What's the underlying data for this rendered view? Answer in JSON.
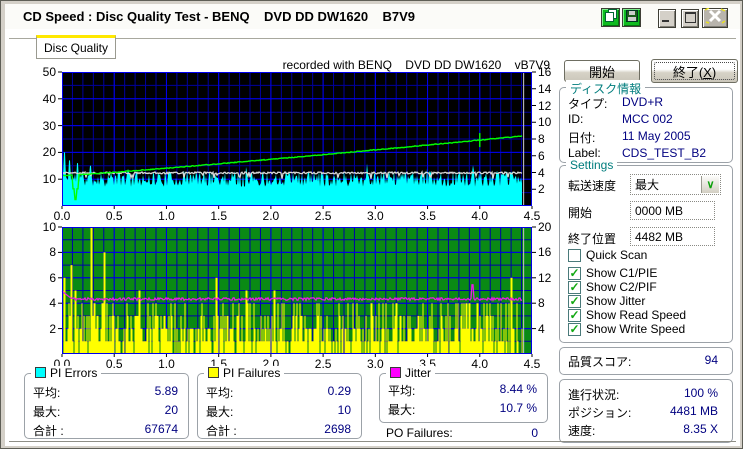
{
  "window": {
    "title": "CD Speed : Disc Quality Test - BENQ    DVD DD DW1620    B7V9"
  },
  "tab": {
    "label": "Disc Quality"
  },
  "chart_header": {
    "recorded_with": "recorded with BENQ    DVD DD DW1620    vB7V9"
  },
  "buttons": {
    "start_label": "開始",
    "exit_label_pre": "終了(",
    "exit_accesskey": "X",
    "exit_label_post": ")"
  },
  "disc_info": {
    "caption": "ディスク情報",
    "type_label": "タイプ:",
    "type_value": "DVD+R",
    "id_label": "ID:",
    "id_value": "MCC 002",
    "date_label": "日付:",
    "date_value": "11 May 2005",
    "label_label": "Label:",
    "label_value": "CDS_TEST_B2"
  },
  "settings": {
    "caption": "Settings",
    "transfer_label": "転送速度",
    "transfer_value": "最大",
    "start_label": "開始",
    "start_value": "0000 MB",
    "end_label": "終了位置",
    "end_value": "4482 MB",
    "checkboxes": [
      {
        "label": "Quick Scan",
        "checked": false
      },
      {
        "label": "Show C1/PIE",
        "checked": true
      },
      {
        "label": "Show C2/PIF",
        "checked": true
      },
      {
        "label": "Show Jitter",
        "checked": true
      },
      {
        "label": "Show Read Speed",
        "checked": true
      },
      {
        "label": "Show Write Speed",
        "checked": true
      }
    ]
  },
  "quality": {
    "label": "品質スコア:",
    "value": "94"
  },
  "status": {
    "progress_label": "進行状況:",
    "progress_value": "100 %",
    "position_label": "ポジション:",
    "position_value": "4481 MB",
    "speed_label": "速度:",
    "speed_value": "8.35 X"
  },
  "stats": {
    "avg_label": "平均:",
    "max_label": "最大:",
    "total_label": "合計 :",
    "pi_errors": {
      "caption": "PI Errors",
      "color": "#00FFFF",
      "avg": "5.89",
      "max": "20",
      "total": "67674"
    },
    "pi_failures": {
      "caption": "PI Failures",
      "color": "#FFFF00",
      "avg": "0.29",
      "max": "10",
      "total": "2698"
    },
    "jitter": {
      "caption": "Jitter",
      "color": "#FF00FF",
      "avg": "8.44 %",
      "max": "10.7 %"
    },
    "po_failures": {
      "label": "PO Failures:",
      "value": "0"
    }
  },
  "chart_data": [
    {
      "type": "area",
      "name": "pi-errors-and-speed",
      "seed": 11,
      "bg": "#000000",
      "grid_minor": "#00009E",
      "grid_major": "#0000EE",
      "marker_color": "#D0D0D0",
      "marker_x": 4.42,
      "data_end_x": 4.4,
      "x": {
        "min": 0,
        "max": 4.5,
        "minor": 0.1,
        "major": 0.5,
        "ticks": [
          [
            0,
            "0.0"
          ],
          [
            0.5,
            "0.5"
          ],
          [
            1,
            "1.0"
          ],
          [
            1.5,
            "1.5"
          ],
          [
            2,
            "2.0"
          ],
          [
            2.5,
            "2.5"
          ],
          [
            3,
            "3.0"
          ],
          [
            3.5,
            "3.5"
          ],
          [
            4,
            "4.0"
          ],
          [
            4.5,
            "4.5"
          ]
        ]
      },
      "left": {
        "max": 50,
        "minor": 5,
        "major": 10,
        "ticks": [
          [
            50,
            "50"
          ],
          [
            40,
            "40"
          ],
          [
            30,
            "30"
          ],
          [
            20,
            "20"
          ],
          [
            10,
            "10"
          ]
        ]
      },
      "right": {
        "max": 16,
        "ticks": [
          [
            16,
            "16"
          ],
          [
            14,
            "14"
          ],
          [
            12,
            "12"
          ],
          [
            10,
            "10"
          ],
          [
            8,
            "8"
          ],
          [
            6,
            "6"
          ],
          [
            4,
            "4"
          ],
          [
            2,
            "2"
          ]
        ]
      },
      "series": [
        {
          "name": "PI Errors",
          "type": "noise-area",
          "color": "#00FFFF",
          "base_min": 7.2,
          "base_max": 13.2,
          "spike_chance": 0.025,
          "spike_add": 5,
          "clamp_max": 20,
          "spikes": [
            [
              0.02,
              20
            ],
            [
              0.07,
              17
            ],
            [
              0.15,
              16
            ],
            [
              0.27,
              15
            ]
          ]
        },
        {
          "name": "band",
          "type": "noise-line",
          "color": "#D8D8D8",
          "base": 12.35,
          "jitter": 0.7,
          "dip_chance": 0.05,
          "dip_depth": 2
        },
        {
          "name": "Write Speed",
          "type": "curve",
          "color": "#00FF00",
          "y_start": 11.3,
          "y_end": 26.1,
          "pow": 1.12,
          "dip": [
            0.13,
            2.4
          ],
          "cross_x": 4.0
        }
      ]
    },
    {
      "type": "bar",
      "name": "pi-failures-and-jitter",
      "seed": 23,
      "bg": "#0A8A14",
      "grid_minor": "#0000A8",
      "grid_major": "#0000E6",
      "marker_color": "#C8C8C8",
      "marker_x": 4.42,
      "data_end_x": 4.4,
      "x": {
        "min": 0,
        "max": 4.5,
        "minor": 0.1,
        "major": 0.5,
        "ticks": [
          [
            0,
            "0.0"
          ],
          [
            0.5,
            "0.5"
          ],
          [
            1,
            "1.0"
          ],
          [
            1.5,
            "1.5"
          ],
          [
            2,
            "2.0"
          ],
          [
            2.5,
            "2.5"
          ],
          [
            3,
            "3.0"
          ],
          [
            3.5,
            "3.5"
          ],
          [
            4,
            "4.0"
          ],
          [
            4.5,
            "4.5"
          ]
        ]
      },
      "left": {
        "max": 10,
        "minor": 1,
        "major": 2,
        "ticks": [
          [
            10,
            "10"
          ],
          [
            8,
            "8"
          ],
          [
            6,
            "6"
          ],
          [
            4,
            "4"
          ],
          [
            2,
            "2"
          ]
        ]
      },
      "right": {
        "max": 20,
        "ticks": [
          [
            20,
            "20"
          ],
          [
            16,
            "16"
          ],
          [
            12,
            "12"
          ],
          [
            8,
            "8"
          ],
          [
            4,
            "4"
          ]
        ]
      },
      "series": [
        {
          "name": "PI Failures",
          "type": "bars",
          "color": "#FFFF00",
          "spikes": [
            [
              0.02,
              6
            ],
            [
              0.09,
              7
            ],
            [
              0.13,
              5
            ],
            [
              0.28,
              10
            ],
            [
              0.41,
              8
            ],
            [
              0.74,
              5
            ],
            [
              1.48,
              6
            ],
            [
              1.77,
              5
            ],
            [
              2.03,
              5
            ],
            [
              2.96,
              4
            ],
            [
              3.9,
              4
            ],
            [
              4.3,
              6
            ]
          ]
        },
        {
          "name": "Jitter",
          "type": "noise-line",
          "color": "#E61EE6",
          "base": 4.33,
          "jitter": 0.2,
          "start": 4.95,
          "start_len": 10,
          "spike": [
            3.93,
            5.45
          ]
        }
      ]
    }
  ]
}
